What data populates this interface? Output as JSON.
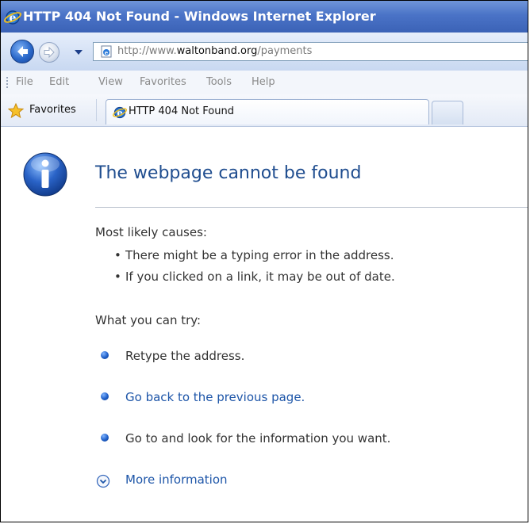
{
  "window": {
    "title": "HTTP 404 Not Found - Windows Internet Explorer"
  },
  "addressbar": {
    "url_prefix": "http://www.",
    "url_domain": "waltonband.org",
    "url_path": "/payments"
  },
  "menubar": {
    "items": [
      "File",
      "Edit",
      "View",
      "Favorites",
      "Tools",
      "Help"
    ]
  },
  "favoritesbar": {
    "favorites_label": "Favorites",
    "tab_label": "HTTP 404 Not Found"
  },
  "page": {
    "heading": "The webpage cannot be found",
    "causes_label": "Most likely causes:",
    "causes": [
      "There might be a typing error in the address.",
      "If you clicked on a link, it may be out of date."
    ],
    "try_label": "What you can try:",
    "try_items": [
      "Retype the address.",
      "Go back to the previous page.",
      "Go to  and look for the information you want."
    ],
    "more_info": "More information"
  },
  "colors": {
    "titlebar": "#4a73c7",
    "heading": "#1f4d8f",
    "link": "#1d55a8",
    "body_text": "#333333"
  },
  "icons": [
    "ie-icon",
    "back-arrow-icon",
    "forward-arrow-icon",
    "dropdown-arrow-icon",
    "page-icon",
    "star-icon",
    "info-icon",
    "bullet-icon",
    "expand-chevron-icon"
  ]
}
